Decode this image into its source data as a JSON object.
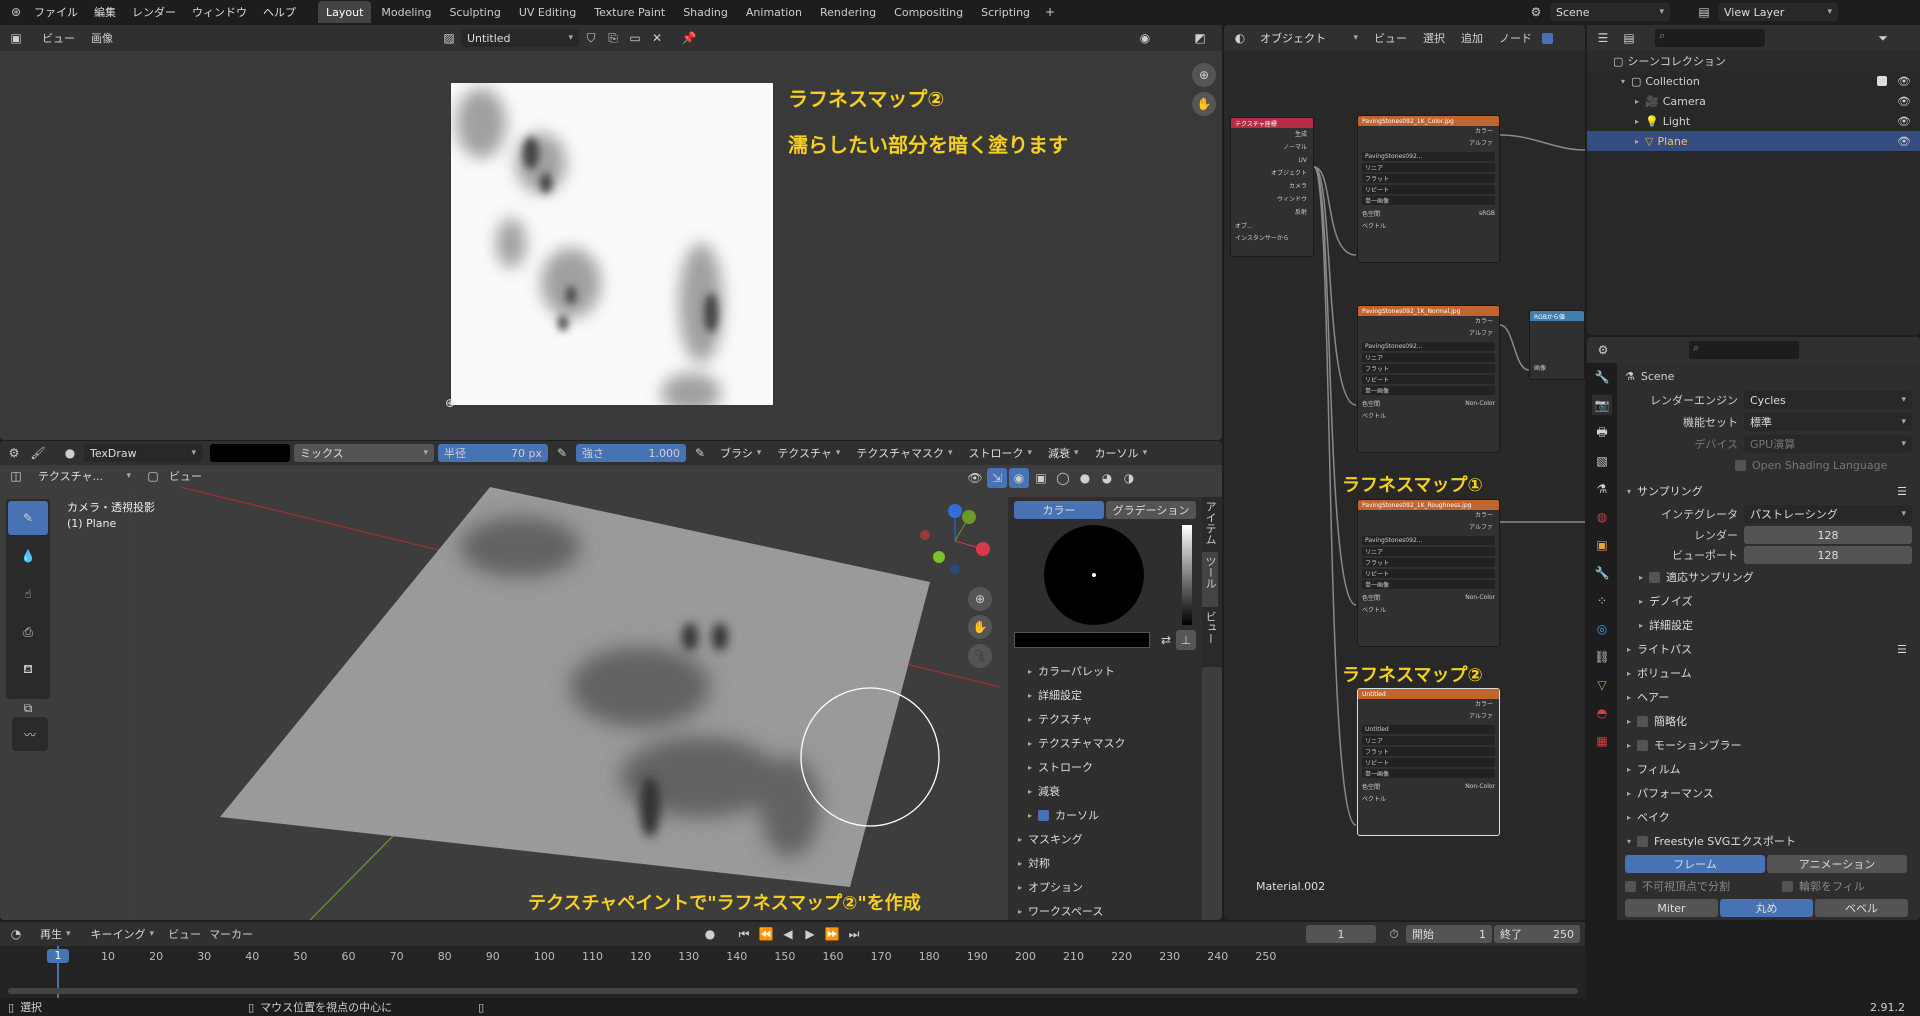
{
  "top_menu": [
    "ファイル",
    "編集",
    "レンダー",
    "ウィンドウ",
    "ヘルプ"
  ],
  "workspace_tabs": [
    "Layout",
    "Modeling",
    "Sculpting",
    "UV Editing",
    "Texture Paint",
    "Shading",
    "Animation",
    "Rendering",
    "Compositing",
    "Scripting"
  ],
  "scene_name": "Scene",
  "view_layer": "View Layer",
  "image_editor": {
    "menu": [
      "ビュー",
      "画像"
    ],
    "image_name": "Untitled"
  },
  "annotation1": "ラフネスマップ②",
  "annotation2": "濡らしたい部分を暗く塗ります",
  "annotation3": "テクスチャペイントで\"ラフネスマップ②\"を作成",
  "annotation4": "ラフネスマップ①",
  "annotation5": "ラフネスマップ②",
  "tool_header": {
    "brush_name": "TexDraw",
    "blend": "ミックス",
    "radius_label": "半径",
    "radius_value": "70 px",
    "strength_label": "強さ",
    "strength_value": "1.000",
    "menus": [
      "ブラシ",
      "テクスチャ",
      "テクスチャマスク",
      "ストローク",
      "減衰",
      "カーソル"
    ]
  },
  "viewport": {
    "mode": "テクスチャ...",
    "view_menu": "ビュー",
    "camera_label": "カメラ・透視投影",
    "object_label": "(1) Plane"
  },
  "sidebar": {
    "tab_color": "カラー",
    "tab_gradient": "グラデーション",
    "vertical_tabs": [
      "アイテム",
      "ツール",
      "ビュー"
    ],
    "sub_panels": [
      "カラーパレット",
      "詳細設定",
      "テクスチャ",
      "テクスチャマスク",
      "ストローク",
      "減衰",
      "カーソル"
    ],
    "panels": [
      "マスキング",
      "対称",
      "オプション",
      "ワークスペース"
    ]
  },
  "node_editor": {
    "mode": "オブジェクト",
    "menus": [
      "ビュー",
      "選択",
      "追加",
      "ノード"
    ],
    "material": "Material.002",
    "texcoord_title": "テクスチャ座標",
    "texcoord_outputs": [
      "生成",
      "ノーマル",
      "UV",
      "オブジェクト",
      "カメラ",
      "ウィンドウ",
      "反射"
    ],
    "texcoord_obj": "オブ...",
    "texcoord_instancer": "インスタンサーから",
    "rgb_node": "RGBから値",
    "rgb_input": "画像",
    "image_nodes": [
      {
        "title": "PavingStones092_1K_Color.jpg",
        "img": "PavingStones092...",
        "colorspace": "sRGB"
      },
      {
        "title": "PavingStones092_1K_Normal.jpg",
        "img": "PavingStones092...",
        "colorspace": "Non-Color"
      },
      {
        "title": "PavingStones092_1K_Roughness.jpg",
        "img": "PavingStones092...",
        "colorspace": "Non-Color"
      },
      {
        "title": "Untitled",
        "img": "Untitled",
        "colorspace": "Non-Color"
      }
    ],
    "node_outputs": [
      "カラー",
      "アルファ"
    ],
    "node_options": [
      "リニア",
      "フラット",
      "リピート",
      "単一画像"
    ],
    "node_colorspace_label": "色空間",
    "node_vector": "ベクトル"
  },
  "outliner": {
    "scene_collection": "シーンコレクション",
    "items": [
      {
        "name": "Collection",
        "depth": 1
      },
      {
        "name": "Camera",
        "depth": 2
      },
      {
        "name": "Light",
        "depth": 2
      },
      {
        "name": "Plane",
        "depth": 2,
        "selected": true
      }
    ]
  },
  "properties": {
    "header": "Scene",
    "render_engine_label": "レンダーエンジン",
    "render_engine": "Cycles",
    "feature_set_label": "機能セット",
    "feature_set": "標準",
    "device_label": "デバイス",
    "device": "GPU演算",
    "osl": "Open Shading Language",
    "sampling": "サンプリング",
    "integrator_label": "インテグレータ",
    "integrator": "パストレーシング",
    "render_label": "レンダー",
    "render_samples": "128",
    "viewport_label": "ビューポート",
    "viewport_samples": "128",
    "adaptive": "適応サンプリング",
    "denoise": "デノイズ",
    "advanced": "詳細設定",
    "panels": [
      "ライトパス",
      "ボリューム",
      "ヘアー",
      "簡略化",
      "モーションブラー",
      "フィルム",
      "パフォーマンス",
      "ベイク",
      "Freestyle SVGエクスポート"
    ],
    "frame_btn": "フレーム",
    "anim_btn": "アニメーション",
    "split_invisible": "不可視頂点で分割",
    "fill_contour": "輪郭をフィル",
    "join_options": [
      "Miter",
      "丸め",
      "ベベル"
    ]
  },
  "timeline": {
    "menus": [
      "再生",
      "キーイング",
      "ビュー",
      "マーカー"
    ],
    "current_frame": "1",
    "start_label": "開始",
    "start": "1",
    "end_label": "終了",
    "end": "250",
    "ticks": [
      "1",
      "10",
      "20",
      "30",
      "40",
      "50",
      "60",
      "70",
      "80",
      "90",
      "100",
      "110",
      "120",
      "130",
      "140",
      "150",
      "160",
      "170",
      "180",
      "190",
      "200",
      "210",
      "220",
      "230",
      "240",
      "250"
    ]
  },
  "status": {
    "select": "選択",
    "center": "マウス位置を視点の中心に",
    "version": "2.91.2"
  }
}
